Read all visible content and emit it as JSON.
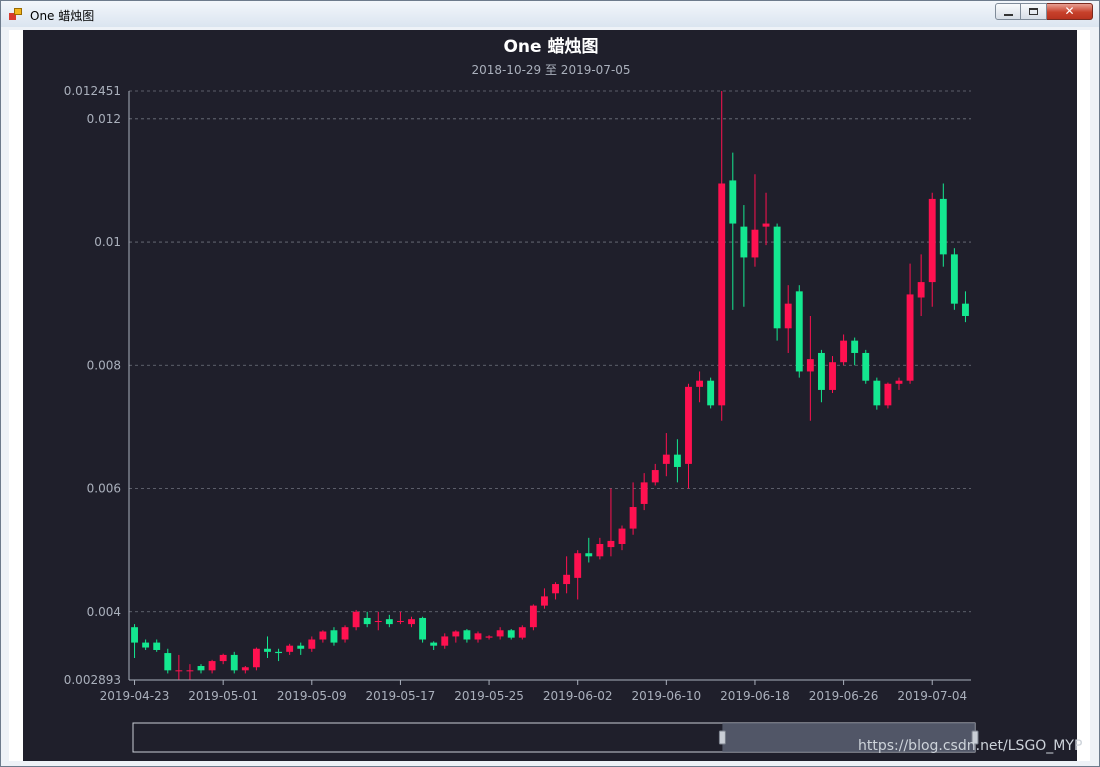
{
  "window": {
    "title": "One 蜡烛图",
    "close_glyph": "✕"
  },
  "watermark": "https://blog.csdn.net/LSGO_MYP",
  "colors": {
    "up": "#ff1150",
    "down": "#14e890",
    "background": "#1f1f2b",
    "grid": "#8a8f9a",
    "text": "#aab0bc",
    "title": "#ffffff"
  },
  "chart_data": {
    "type": "candlestick",
    "title": "One 蜡烛图",
    "subtitle": "2018-10-29 至 2019-07-05",
    "ylim": [
      0.002893,
      0.012451
    ],
    "y_ticks": [
      "0.002893",
      "0.004",
      "0.006",
      "0.008",
      "0.01",
      "0.012",
      "0.012451"
    ],
    "y_tick_values": [
      0.002893,
      0.004,
      0.006,
      0.008,
      0.01,
      0.012,
      0.012451
    ],
    "x_tick_labels": [
      "2019-04-23",
      "2019-05-01",
      "2019-05-09",
      "2019-05-17",
      "2019-05-25",
      "2019-06-02",
      "2019-06-10",
      "2019-06-18",
      "2019-06-26",
      "2019-07-04"
    ],
    "x_tick_index": [
      0,
      8,
      16,
      24,
      32,
      40,
      48,
      56,
      64,
      72
    ],
    "grid": "horizontal-dashed",
    "legend": "none",
    "candles": [
      [
        0.00375,
        0.0035,
        0.00325,
        0.0038
      ],
      [
        0.0035,
        0.00342,
        0.00338,
        0.00355
      ],
      [
        0.0035,
        0.00338,
        0.00335,
        0.00355
      ],
      [
        0.00333,
        0.00305,
        0.003,
        0.0034
      ],
      [
        0.00305,
        0.00305,
        0.0029,
        0.0033
      ],
      [
        0.00305,
        0.00305,
        0.0029,
        0.00315
      ],
      [
        0.00312,
        0.00305,
        0.003,
        0.00315
      ],
      [
        0.00305,
        0.0032,
        0.003,
        0.00322
      ],
      [
        0.0032,
        0.0033,
        0.00315,
        0.00332
      ],
      [
        0.0033,
        0.00305,
        0.003,
        0.00335
      ],
      [
        0.00305,
        0.0031,
        0.003,
        0.00312
      ],
      [
        0.0031,
        0.0034,
        0.00305,
        0.00342
      ],
      [
        0.0034,
        0.00335,
        0.00325,
        0.0036
      ],
      [
        0.00335,
        0.00333,
        0.0032,
        0.0034
      ],
      [
        0.00335,
        0.00345,
        0.0033,
        0.00348
      ],
      [
        0.00345,
        0.0034,
        0.0033,
        0.0035
      ],
      [
        0.0034,
        0.00355,
        0.00335,
        0.0036
      ],
      [
        0.00355,
        0.00368,
        0.0035,
        0.0037
      ],
      [
        0.0037,
        0.0035,
        0.00345,
        0.00375
      ],
      [
        0.00355,
        0.00375,
        0.0035,
        0.00378
      ],
      [
        0.00375,
        0.004,
        0.0037,
        0.00403
      ],
      [
        0.0039,
        0.0038,
        0.00375,
        0.004
      ],
      [
        0.00385,
        0.00385,
        0.0037,
        0.004
      ],
      [
        0.00388,
        0.0038,
        0.00375,
        0.00395
      ],
      [
        0.00385,
        0.00385,
        0.0038,
        0.004
      ],
      [
        0.0038,
        0.00388,
        0.00375,
        0.00392
      ],
      [
        0.0039,
        0.00355,
        0.0035,
        0.00392
      ],
      [
        0.0035,
        0.00345,
        0.00338,
        0.00352
      ],
      [
        0.00345,
        0.0036,
        0.0034,
        0.00365
      ],
      [
        0.0036,
        0.00368,
        0.0035,
        0.0037
      ],
      [
        0.0037,
        0.00355,
        0.0035,
        0.00372
      ],
      [
        0.00355,
        0.00365,
        0.0035,
        0.00368
      ],
      [
        0.00358,
        0.0036,
        0.00355,
        0.00362
      ],
      [
        0.0036,
        0.0037,
        0.00355,
        0.00375
      ],
      [
        0.0037,
        0.00358,
        0.00355,
        0.00372
      ],
      [
        0.00358,
        0.00375,
        0.00355,
        0.00378
      ],
      [
        0.00375,
        0.0041,
        0.0037,
        0.00412
      ],
      [
        0.0041,
        0.00425,
        0.00405,
        0.00438
      ],
      [
        0.0043,
        0.00445,
        0.0042,
        0.00448
      ],
      [
        0.00445,
        0.0046,
        0.0043,
        0.0049
      ],
      [
        0.00455,
        0.00495,
        0.0042,
        0.005
      ],
      [
        0.00495,
        0.0049,
        0.0048,
        0.0052
      ],
      [
        0.0049,
        0.0051,
        0.00485,
        0.0052
      ],
      [
        0.00505,
        0.00515,
        0.0049,
        0.006
      ],
      [
        0.0051,
        0.00535,
        0.005,
        0.0054
      ],
      [
        0.00535,
        0.0057,
        0.00525,
        0.0061
      ],
      [
        0.00575,
        0.0061,
        0.00565,
        0.00625
      ],
      [
        0.0061,
        0.0063,
        0.00605,
        0.0064
      ],
      [
        0.0064,
        0.00655,
        0.0062,
        0.0069
      ],
      [
        0.00655,
        0.00635,
        0.0061,
        0.0068
      ],
      [
        0.0064,
        0.00765,
        0.006,
        0.0077
      ],
      [
        0.00765,
        0.00775,
        0.0074,
        0.0079
      ],
      [
        0.00775,
        0.00735,
        0.0073,
        0.0078
      ],
      [
        0.00735,
        0.01095,
        0.0071,
        0.01245
      ],
      [
        0.011,
        0.0103,
        0.0089,
        0.01145
      ],
      [
        0.01025,
        0.00975,
        0.00895,
        0.0106
      ],
      [
        0.00975,
        0.0102,
        0.0096,
        0.0111
      ],
      [
        0.01025,
        0.0103,
        0.00995,
        0.0108
      ],
      [
        0.01025,
        0.0086,
        0.0084,
        0.0103
      ],
      [
        0.0086,
        0.009,
        0.0082,
        0.0093
      ],
      [
        0.0092,
        0.0079,
        0.0078,
        0.0093
      ],
      [
        0.0079,
        0.0081,
        0.0071,
        0.0088
      ],
      [
        0.0082,
        0.0076,
        0.0074,
        0.00825
      ],
      [
        0.0076,
        0.00805,
        0.00755,
        0.00815
      ],
      [
        0.00805,
        0.0084,
        0.008,
        0.0085
      ],
      [
        0.0084,
        0.0082,
        0.008,
        0.00845
      ],
      [
        0.0082,
        0.00775,
        0.0077,
        0.00825
      ],
      [
        0.00775,
        0.00735,
        0.00728,
        0.0078
      ],
      [
        0.00735,
        0.0077,
        0.0073,
        0.00772
      ],
      [
        0.0077,
        0.00775,
        0.0076,
        0.0078
      ],
      [
        0.00775,
        0.00915,
        0.0077,
        0.00965
      ],
      [
        0.0091,
        0.00935,
        0.0088,
        0.0098
      ],
      [
        0.00935,
        0.0107,
        0.00895,
        0.0108
      ],
      [
        0.0107,
        0.0098,
        0.0096,
        0.01095
      ],
      [
        0.0098,
        0.009,
        0.0089,
        0.0099
      ],
      [
        0.009,
        0.0088,
        0.0087,
        0.0092
      ]
    ],
    "data_zoom": {
      "start_percent": 70,
      "end_percent": 100
    }
  }
}
